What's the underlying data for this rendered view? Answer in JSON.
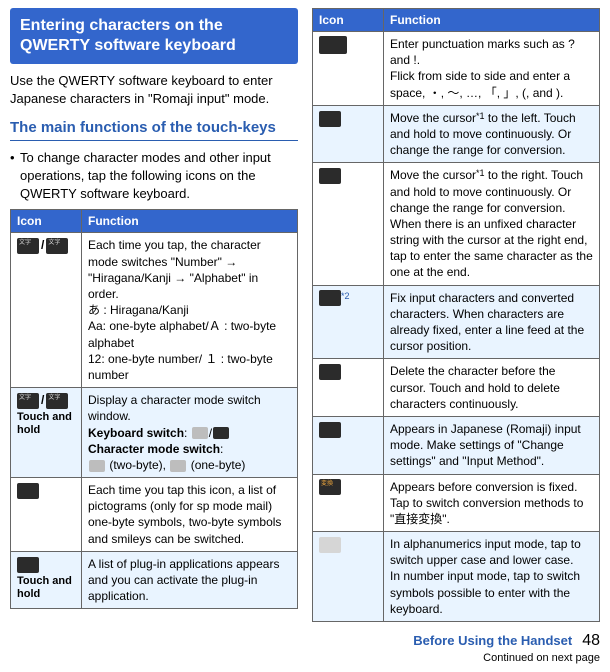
{
  "left": {
    "heading": "Entering characters on the QWERTY software keyboard",
    "intro": "Use the QWERTY software keyboard to enter Japanese characters in \"Romaji input\" mode.",
    "subheading": "The main functions of the touch-keys",
    "bullet": "To change character modes and other input operations, tap the following icons on the QWERTY software keyboard.",
    "table_head_icon": "Icon",
    "table_head_func": "Function",
    "rows": [
      {
        "func": "Each time you tap, the character mode switches \"Number\" → \"Hiragana/Kanji → \"Alphabet\" in order.\nあ : Hiragana/Kanji\nAa: one-byte alphabet/Ａ : two-byte alphabet\n12: one-byte number/ １ : two-byte number"
      },
      {
        "hold": "Touch and hold",
        "func_pre": "Display a character mode switch window.",
        "kb_label": "Keyboard switch",
        "cm_label": "Character mode switch",
        "two": " (two-byte), ",
        "one": " (one-byte)"
      },
      {
        "func": "Each time you tap this icon, a list of pictograms (only for sp mode mail) one-byte symbols, two-byte symbols and smileys can be switched."
      },
      {
        "hold": "Touch and hold",
        "func": "A list of plug-in applications appears and you can activate the plug-in application."
      }
    ]
  },
  "right": {
    "table_head_icon": "Icon",
    "table_head_func": "Function",
    "rows": [
      {
        "func": "Enter punctuation marks such as ? and !.\nFlick from side to side and enter a space, ・, 〜, …, 「, 」, (, and )."
      },
      {
        "func_pre": "Move the cursor",
        "sup": "*1",
        "func_post": " to the left. Touch and hold to move continuously. Or change the range for conversion."
      },
      {
        "func_pre": "Move the cursor",
        "sup": "*1",
        "func_post": " to the right. Touch and hold to move continuously. Or change the range for conversion. When there is an unfixed character string with the cursor at the right end, tap to enter the same character as the one at the end."
      },
      {
        "sup_icon": "*2",
        "func": "Fix input characters and converted characters. When characters are already fixed, enter a line feed at the cursor position."
      },
      {
        "func": "Delete the character before the cursor. Touch and hold to delete characters continuously."
      },
      {
        "func": "Appears in Japanese (Romaji) input mode. Make settings of \"Change settings\" and \"Input Method\"."
      },
      {
        "func": "Appears before conversion is fixed. Tap to switch conversion methods to \"直接変換\"."
      },
      {
        "func": "In alphanumerics input mode, tap to switch upper case and lower case.\nIn number input mode, tap to switch symbols possible to enter with the keyboard."
      }
    ]
  },
  "footer": {
    "before": "Before Using the Handset",
    "page": "48",
    "cont": "Continued on next page"
  }
}
